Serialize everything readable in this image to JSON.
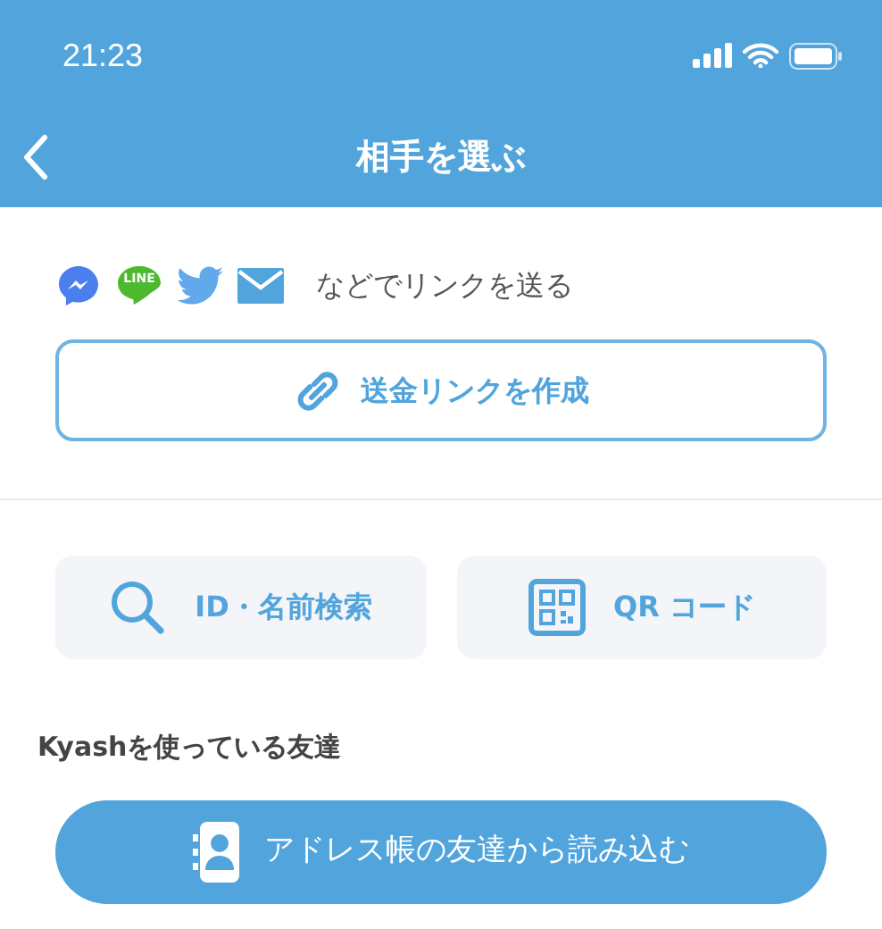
{
  "status_bar": {
    "time": "21:23"
  },
  "nav": {
    "title": "相手を選ぶ"
  },
  "share": {
    "services": [
      {
        "kind": "messenger"
      },
      {
        "kind": "line",
        "label": "LINE"
      },
      {
        "kind": "twitter"
      },
      {
        "kind": "mail"
      }
    ],
    "text": "などでリンクを送る",
    "button": "送金リンクを作成"
  },
  "actions": [
    {
      "kind": "search",
      "label": "ID・名前検索"
    },
    {
      "kind": "qr",
      "label": "QR コード"
    }
  ],
  "friends": {
    "heading": "Kyashを使っている友達",
    "button": "アドレス帳の友達から読み込む"
  }
}
